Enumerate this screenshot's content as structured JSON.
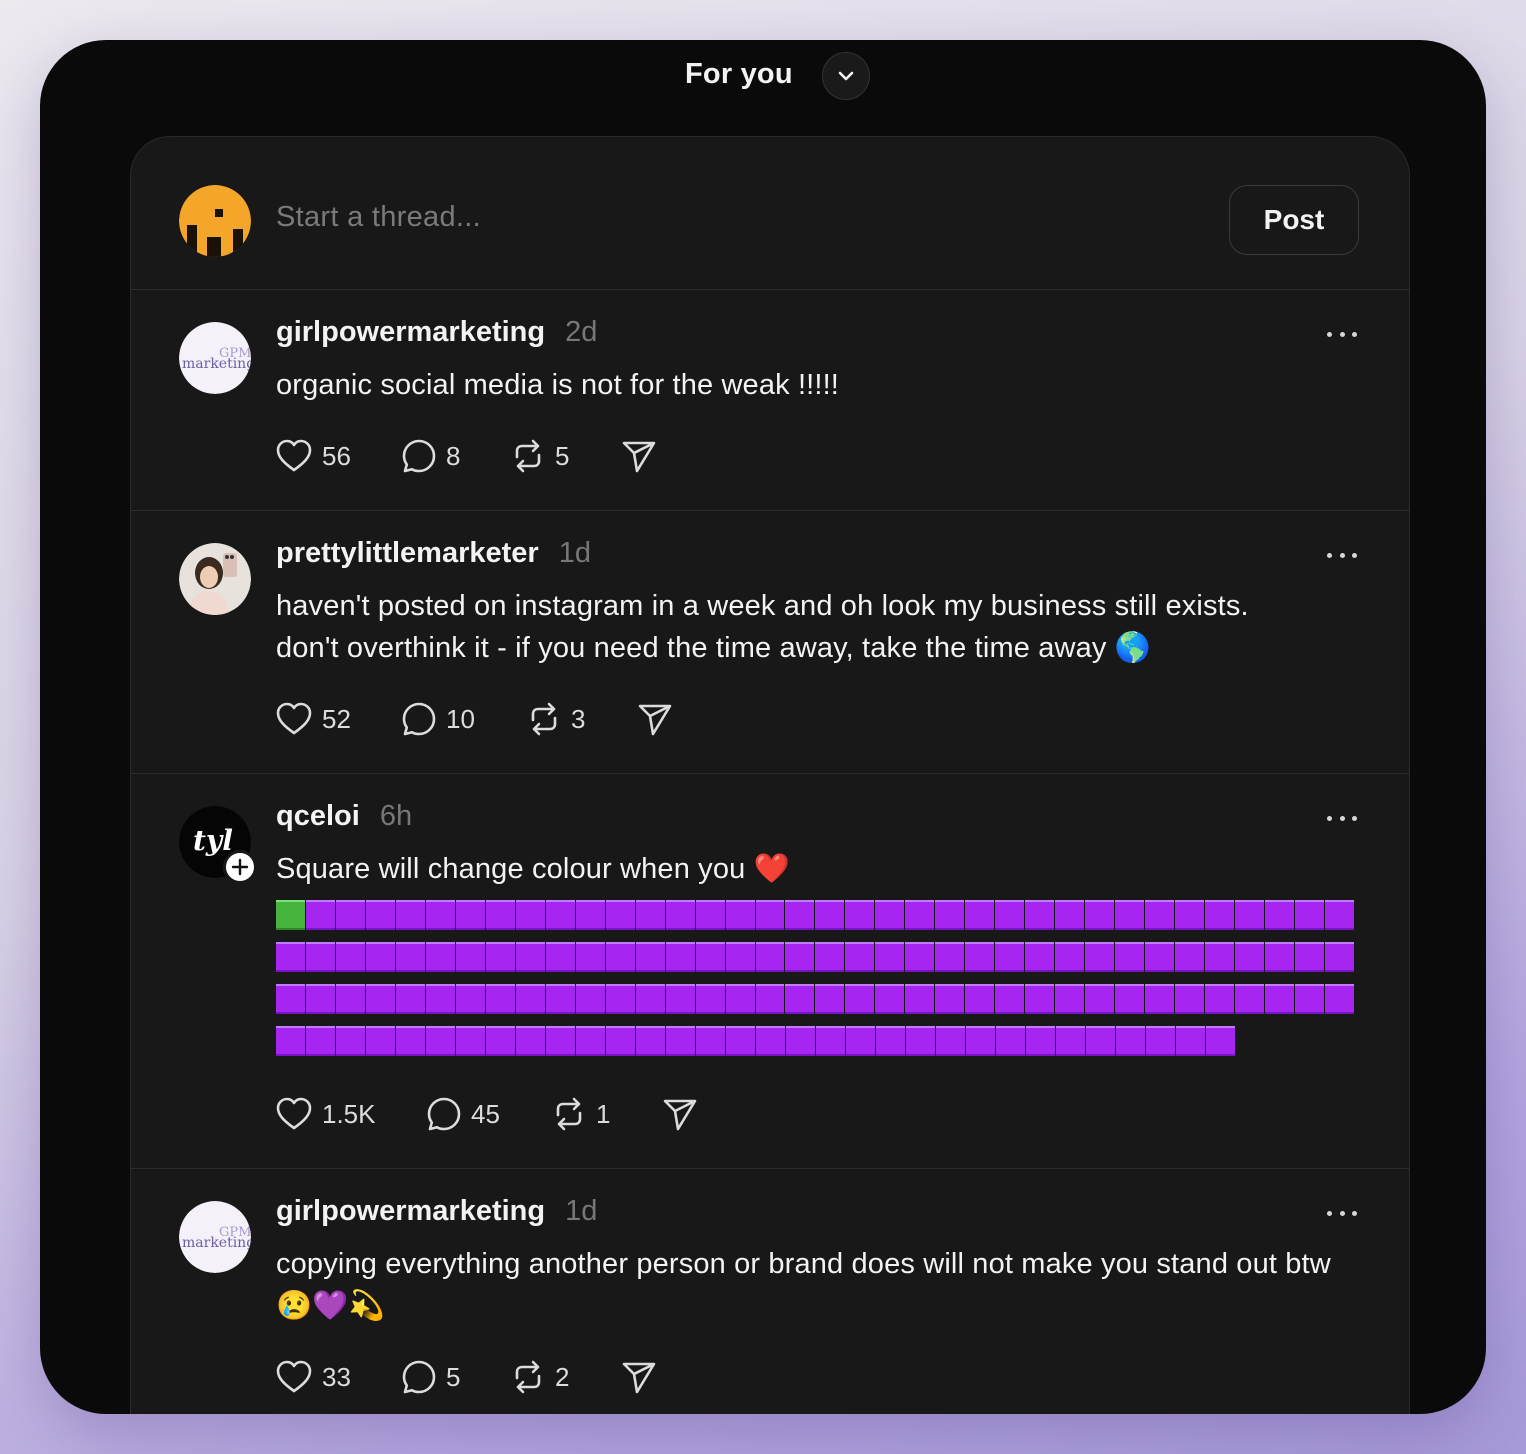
{
  "header": {
    "title": "For you",
    "dropdown_icon": "chevron-down-icon"
  },
  "composer": {
    "placeholder": "Start a thread...",
    "post_label": "Post"
  },
  "posts": [
    {
      "username": "girlpowermarketing",
      "time": "2d",
      "text": "organic social media is not for the weak !!!!!",
      "likes": "56",
      "replies": "8",
      "reposts": "5",
      "avatar_text": "GPM marketing"
    },
    {
      "username": "prettylittlemarketer",
      "time": "1d",
      "text": "haven't posted on instagram in a week and oh look my business still exists.\ndon't overthink it - if you need the time away, take the time away 🌎",
      "likes": "52",
      "replies": "10",
      "reposts": "3"
    },
    {
      "username": "qceloi",
      "time": "6h",
      "text": "Square will change colour when you ❤️",
      "likes": "1.5K",
      "replies": "45",
      "reposts": "1",
      "avatar_text": "tyl",
      "squares": {
        "green": 1,
        "purple": 139,
        "per_row": 36
      }
    },
    {
      "username": "girlpowermarketing",
      "time": "1d",
      "text": "copying everything another person or brand does will not make you stand out btw 😢💜💫",
      "likes": "33",
      "replies": "5",
      "reposts": "2",
      "avatar_text": "GPM marketing"
    }
  ],
  "colors": {
    "background": "#0a0a0a",
    "card": "#181818",
    "text": "#f3f3f3",
    "muted": "#777777",
    "square_purple": "#a625f0",
    "square_green": "#47b53d",
    "composer_avatar": "#f4a62a"
  }
}
